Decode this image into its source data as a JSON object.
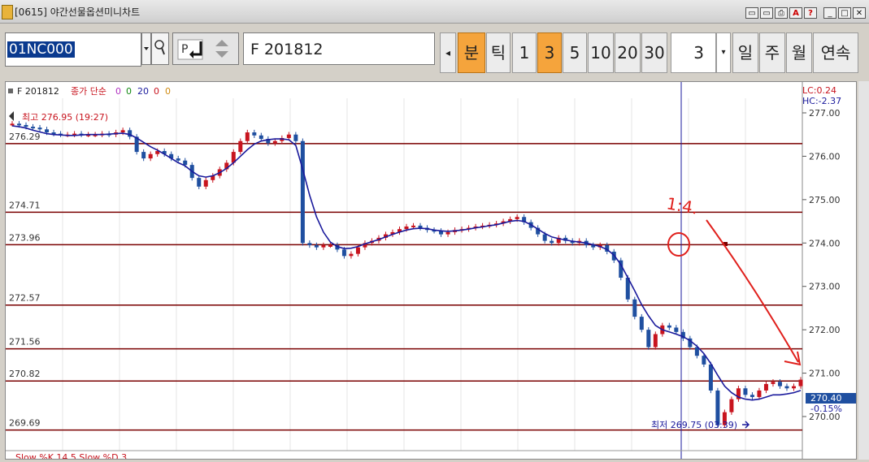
{
  "window": {
    "title": "[0615]  야간선물옵션미니차트",
    "buttons": [
      "▭",
      "▭",
      "⎙",
      "A",
      "?",
      "_",
      "□",
      "✕"
    ]
  },
  "toolbar": {
    "code_value": "01NC000",
    "name_value": "F  201812",
    "period_buttons": [
      {
        "label": "분",
        "active": true
      },
      {
        "label": "틱",
        "active": false
      },
      {
        "label": "1",
        "active": false
      },
      {
        "label": "3",
        "active": true
      },
      {
        "label": "5",
        "active": false
      },
      {
        "label": "10",
        "active": false
      },
      {
        "label": "20",
        "active": false
      },
      {
        "label": "30",
        "active": false
      }
    ],
    "interval_value": "3",
    "range_buttons": [
      "일",
      "주",
      "월",
      "연속"
    ]
  },
  "chart": {
    "legend": {
      "symbol": "F 201812",
      "indicator": "종가 단순",
      "params": [
        "0",
        "0",
        "20",
        "0",
        "0"
      ]
    },
    "lc_label": "LC:0.24",
    "hc_label": "HC:-2.37",
    "high_label": "최고 276.95 (19:27)",
    "low_label": "최저 269.75 (03:39)",
    "current_price": "270.40",
    "current_change": "-0.15%",
    "annotation_text": "1:4.",
    "bottom_label": "Slow %K 14,5  Slow %D 3",
    "colors": {
      "up": "#c8141e",
      "down": "#1f4fa0",
      "ma": "#1a1a9c",
      "level": "#7a0000",
      "annotation": "#e0201c",
      "axis_text": "#333333"
    }
  },
  "chart_data": {
    "type": "line",
    "title": "F 201812",
    "x_label": "",
    "y_label": "",
    "ylim": [
      269.3,
      277.3
    ],
    "yticks": [
      277.0,
      276.0,
      275.0,
      274.0,
      273.0,
      272.0,
      271.0,
      270.0
    ],
    "levels": [
      276.29,
      274.71,
      273.96,
      272.57,
      271.56,
      270.82,
      269.69
    ],
    "series": [
      {
        "values": [
          276.75,
          276.72,
          276.68,
          276.66,
          276.62,
          276.55,
          276.52,
          276.5,
          276.5,
          276.52,
          276.5,
          276.5,
          276.5,
          276.52,
          276.5,
          276.55,
          276.6,
          276.45,
          276.1,
          275.95,
          276.05,
          276.12,
          276.05,
          275.95,
          275.9,
          275.8,
          275.5,
          275.3,
          275.45,
          275.55,
          275.7,
          275.85,
          276.1,
          276.35,
          276.55,
          276.48,
          276.4,
          276.3,
          276.35,
          276.42,
          276.5,
          276.35,
          274.0,
          273.95,
          273.9,
          273.95,
          273.95,
          273.85,
          273.7,
          273.75,
          273.9,
          274.0,
          274.05,
          274.12,
          274.2,
          274.25,
          274.32,
          274.38,
          274.4,
          274.35,
          274.3,
          274.28,
          274.2,
          274.25,
          274.3,
          274.32,
          274.35,
          274.38,
          274.4,
          274.42,
          274.45,
          274.5,
          274.55,
          274.6,
          274.48,
          274.35,
          274.2,
          274.05,
          274.0,
          274.12,
          274.05,
          274.0,
          274.05,
          273.95,
          273.9,
          273.95,
          273.8,
          273.6,
          273.2,
          272.7,
          272.3,
          272.0,
          271.6,
          271.9,
          272.1,
          272.05,
          271.95,
          271.8,
          271.6,
          271.4,
          271.2,
          270.6,
          269.8,
          270.1,
          270.4,
          270.65,
          270.5,
          270.45,
          270.6,
          270.75,
          270.8,
          270.7,
          270.65,
          270.7,
          270.85
        ],
        "ma": [
          276.7,
          276.68,
          276.65,
          276.6,
          276.56,
          276.52,
          276.5,
          276.49,
          276.48,
          276.48,
          276.49,
          276.5,
          276.5,
          276.5,
          276.51,
          276.52,
          276.53,
          276.5,
          276.42,
          276.32,
          276.22,
          276.14,
          276.05,
          275.95,
          275.85,
          275.78,
          275.65,
          275.55,
          275.52,
          275.55,
          275.62,
          275.72,
          275.85,
          276.0,
          276.15,
          276.28,
          276.35,
          276.38,
          276.4,
          276.4,
          276.38,
          276.25,
          275.7,
          275.1,
          274.6,
          274.25,
          274.02,
          273.92,
          273.87,
          273.88,
          273.92,
          273.98,
          274.03,
          274.08,
          274.14,
          274.2,
          274.25,
          274.3,
          274.33,
          274.34,
          274.33,
          274.3,
          274.28,
          274.27,
          274.28,
          274.3,
          274.32,
          274.35,
          274.37,
          274.4,
          274.42,
          274.46,
          274.5,
          274.52,
          274.5,
          274.42,
          274.32,
          274.22,
          274.14,
          274.1,
          274.07,
          274.04,
          274.02,
          274.0,
          273.96,
          273.92,
          273.85,
          273.72,
          273.5,
          273.2,
          272.9,
          272.58,
          272.32,
          272.1,
          272.0,
          271.95,
          271.9,
          271.84,
          271.75,
          271.62,
          271.45,
          271.22,
          270.95,
          270.7,
          270.55,
          270.45,
          270.4,
          270.38,
          270.4,
          270.45,
          270.5,
          270.5,
          270.52,
          270.55,
          270.6
        ]
      }
    ]
  }
}
